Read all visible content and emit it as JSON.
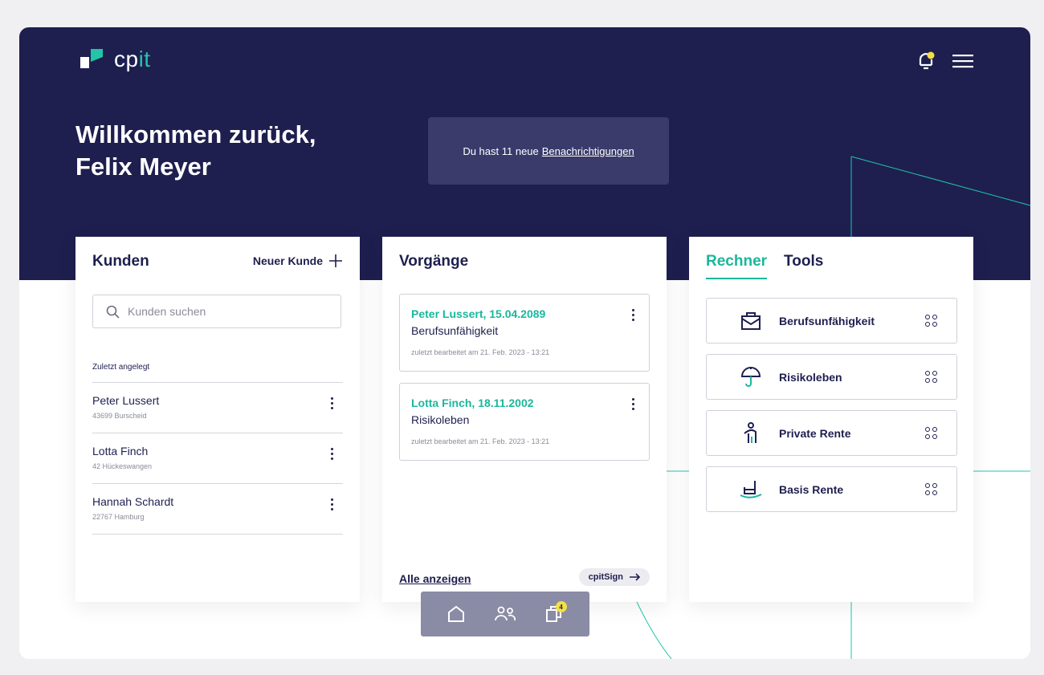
{
  "brand": {
    "name_main": "cp",
    "name_accent": "it"
  },
  "header": {
    "welcome_line1": "Willkommen zurück,",
    "welcome_line2": "Felix Meyer",
    "notice_prefix": "Du hast 11 neue",
    "notice_link": "Benachrichtigungen"
  },
  "customers": {
    "title": "Kunden",
    "new_label": "Neuer Kunde",
    "search_placeholder": "Kunden suchen",
    "recent_label": "Zuletzt angelegt",
    "items": [
      {
        "name": "Peter Lussert",
        "city": "43699 Burscheid"
      },
      {
        "name": "Lotta Finch",
        "city": "42 Hückeswangen"
      },
      {
        "name": "Hannah Schardt",
        "city": "22767 Hamburg"
      }
    ]
  },
  "processes": {
    "title": "Vorgänge",
    "items": [
      {
        "title": "Peter Lussert, 15.04.2089",
        "type": "Berufsunfähigkeit",
        "meta": "zuletzt bearbeitet am 21. Feb. 2023 - 13:21"
      },
      {
        "title": "Lotta Finch, 18.11.2002",
        "type": "Risikoleben",
        "meta": "zuletzt bearbeitet am 21. Feb. 2023 - 13:21"
      }
    ],
    "all_label": "Alle anzeigen",
    "sign_label": "cpitSign"
  },
  "calculator": {
    "tabs": [
      "Rechner",
      "Tools"
    ],
    "active_tab": "Rechner",
    "items": [
      {
        "label": "Berufsunfähigkeit",
        "icon": "briefcase-icon"
      },
      {
        "label": "Risikoleben",
        "icon": "umbrella-icon"
      },
      {
        "label": "Private Rente",
        "icon": "person-walking-icon"
      },
      {
        "label": "Basis Rente",
        "icon": "rocking-chair-icon"
      }
    ]
  },
  "bottom_nav": {
    "badge_count": "4"
  },
  "colors": {
    "navy": "#1e1f4f",
    "teal": "#1ab79c",
    "notification_dot": "#f2e046"
  }
}
